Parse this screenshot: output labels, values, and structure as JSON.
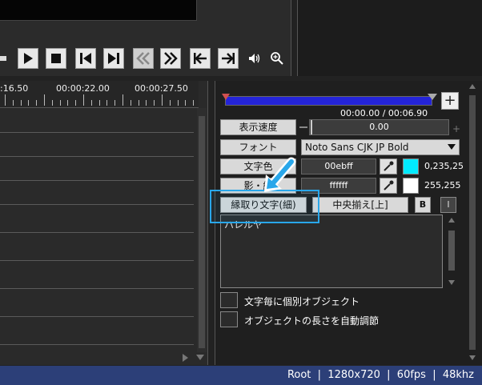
{
  "playback": {
    "buttons": [
      "play",
      "stop",
      "prev-frame",
      "next-frame",
      "rewind",
      "fast-forward",
      "go-start",
      "go-end"
    ]
  },
  "timeline": {
    "ruler_labels": [
      ":16.50",
      "00:00:22.00",
      "00:00:27.50"
    ]
  },
  "seek": {
    "time_readout": "00:00.00 / 00:06.90",
    "plus_label": "+"
  },
  "props": {
    "speed_label": "表示速度",
    "speed_value": "0.00",
    "font_label": "フォント",
    "font_value": "Noto Sans CJK JP Bold",
    "text_color_label": "文字色",
    "text_color_hex": "00ebff",
    "text_color_rgb": "0,235,25",
    "text_color_swatch": "#00ebff",
    "shadow_color_label": "影・縁",
    "shadow_color_hex": "ffffff",
    "shadow_color_rgb": "255,255",
    "shadow_color_swatch": "#ffffff",
    "outline_label": "縁取り文字(細)",
    "align_label": "中央揃え[上]",
    "bold_label": "B",
    "italic_label": "I",
    "text_content": "ハレルヤ",
    "checkbox_per_char": "文字毎に個別オブジェクト",
    "checkbox_auto_length": "オブジェクトの長さを自動調節"
  },
  "status": {
    "text": "Root  |  1280x720  |  60fps  |  48khz"
  },
  "colors": {
    "seekbar": "#2424d8",
    "highlight": "#29a7ea",
    "statusbar": "#2c3f78"
  }
}
